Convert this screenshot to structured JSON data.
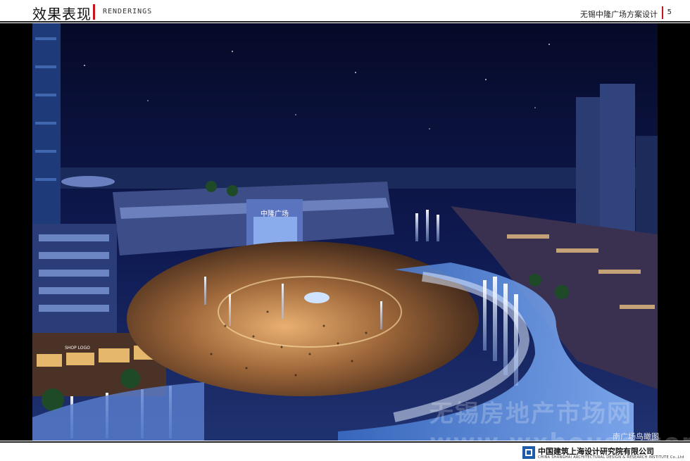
{
  "header": {
    "section_title": "效果表现",
    "section_title_en": "RENDERINGS",
    "project_title": "无锡中隆广场方案设计",
    "page_number": "5"
  },
  "rendering": {
    "building_sign": "中隆广场",
    "shop_sign": "SHOP LOGO",
    "caption": "南广场鸟瞰图",
    "watermark": "无锡房地产市场网 www.wxhouse.com"
  },
  "footer": {
    "company_cn": "中国建筑上海设计研究院有限公司",
    "company_en": "CHINA SHANGHAI ARCHITECTURAL DESIGN & RESEARCH INSTITUTE Co.,Ltd"
  },
  "colors": {
    "accent_red": "#c8141e",
    "sky": "#0b1440",
    "logo_blue": "#1e5ba8"
  }
}
